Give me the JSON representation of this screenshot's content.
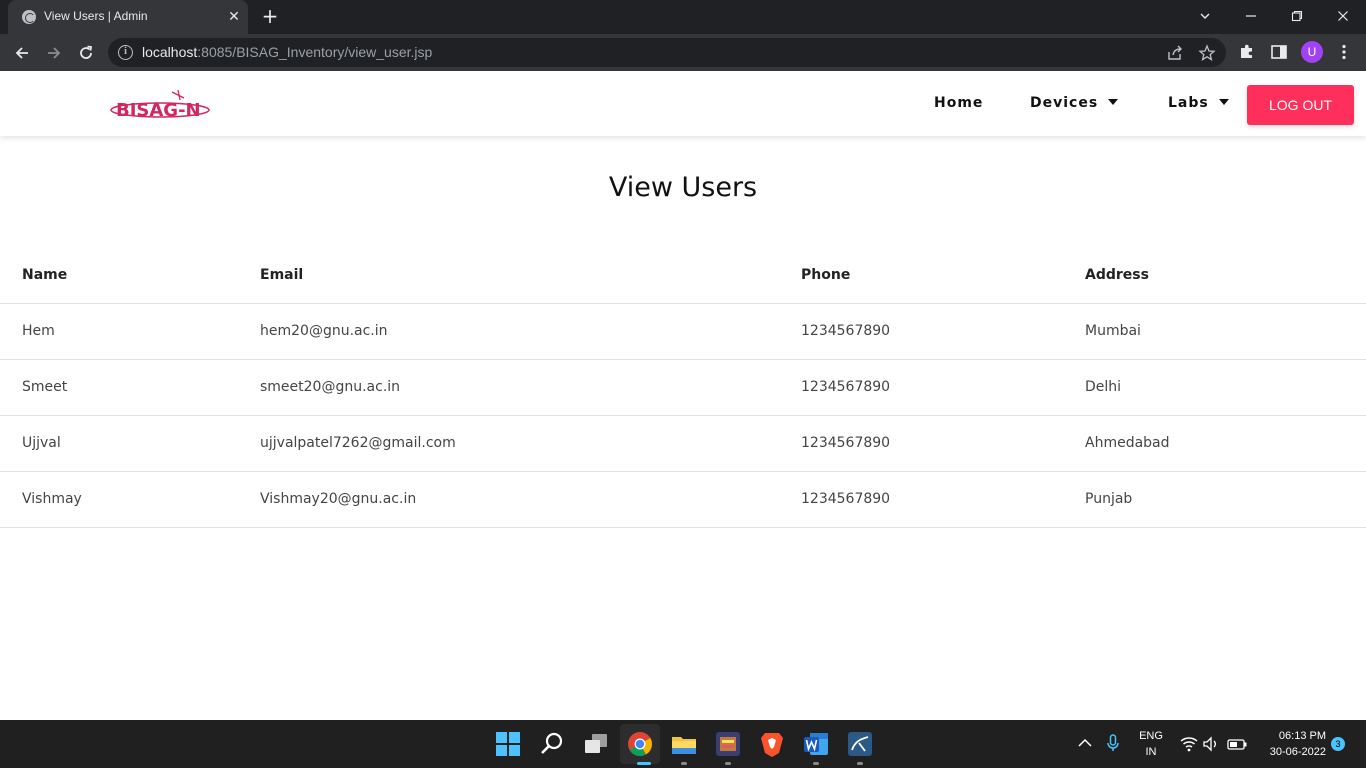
{
  "browser": {
    "tab_title": "View Users | Admin",
    "url_host": "localhost",
    "url_rest": ":8085/BISAG_Inventory/view_user.jsp",
    "profile_initial": "U"
  },
  "navbar": {
    "logo_text": "BISAG-N",
    "links": [
      {
        "label": "Home"
      },
      {
        "label": "Devices"
      },
      {
        "label": "Labs"
      }
    ],
    "logout_label": "LOG OUT"
  },
  "main": {
    "title": "View Users",
    "columns": [
      "Name",
      "Email",
      "Phone",
      "Address"
    ],
    "rows": [
      [
        "Hem",
        "hem20@gnu.ac.in",
        "1234567890",
        "Mumbai"
      ],
      [
        "Smeet",
        "smeet20@gnu.ac.in",
        "1234567890",
        "Delhi"
      ],
      [
        "Ujjval",
        "ujjvalpatel7262@gmail.com",
        "1234567890",
        "Ahmedabad"
      ],
      [
        "Vishmay",
        "Vishmay20@gnu.ac.in",
        "1234567890",
        "Punjab"
      ]
    ]
  },
  "taskbar": {
    "language_line1": "ENG",
    "language_line2": "IN",
    "time": "06:13 PM",
    "date": "30-06-2022",
    "notification_count": "3"
  },
  "colors": {
    "accent": "#fe2f5a",
    "chrome_bg": "#202124",
    "toolbar_bg": "#35363a",
    "taskbar_bg": "#202020"
  }
}
